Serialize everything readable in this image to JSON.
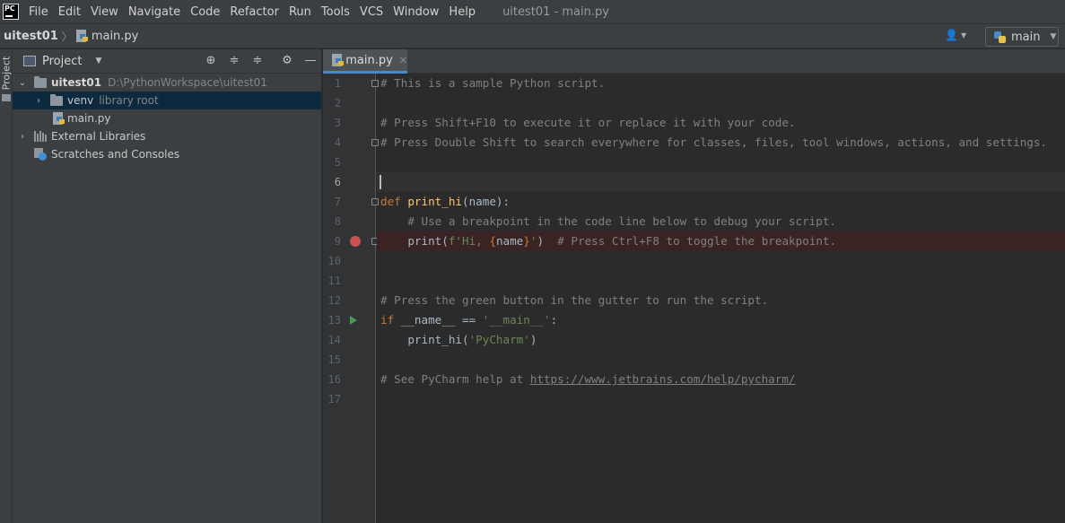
{
  "menubar": {
    "logo_text": "PC",
    "items": [
      "File",
      "Edit",
      "View",
      "Navigate",
      "Code",
      "Refactor",
      "Run",
      "Tools",
      "VCS",
      "Window",
      "Help"
    ],
    "window_title": "uitest01 - main.py"
  },
  "navbar": {
    "project": "uitest01",
    "file": "main.py",
    "run_config": "main"
  },
  "tool_strip": {
    "project_label": "Project"
  },
  "project_panel": {
    "title": "Project",
    "tree": {
      "root_name": "uitest01",
      "root_path": "D:\\PythonWorkspace\\uitest01",
      "venv_name": "venv",
      "venv_note": "library root",
      "file_name": "main.py",
      "ext_libs": "External Libraries",
      "scratches": "Scratches and Consoles"
    }
  },
  "editor": {
    "tab_label": "main.py",
    "line_numbers": [
      "1",
      "2",
      "3",
      "4",
      "5",
      "6",
      "7",
      "8",
      "9",
      "10",
      "11",
      "12",
      "13",
      "14",
      "15",
      "16",
      "17"
    ],
    "code": {
      "l1": "# This is a sample Python script.",
      "l3": "# Press Shift+F10 to execute it or replace it with your code.",
      "l4": "# Press Double Shift to search everywhere for classes, files, tool windows, actions, and settings.",
      "l7_kw": "def",
      "l7_fn": "print_hi",
      "l7_rest": "(name):",
      "l8": "# Use a breakpoint in the code line below to debug your script.",
      "l9_a": "print(",
      "l9_str1": "f'Hi, ",
      "l9_f1": "{",
      "l9_var": "name",
      "l9_f2": "}",
      "l9_str2": "'",
      "l9_b": ")",
      "l9_cmt": "# Press Ctrl+F8 to toggle the breakpoint.",
      "l12": "# Press the green button in the gutter to run the script.",
      "l13_kw": "if",
      "l13_mid": " __name__ == ",
      "l13_str": "'__main__'",
      "l13_end": ":",
      "l14_a": "print_hi(",
      "l14_str": "'PyCharm'",
      "l14_b": ")",
      "l16_pre": "# See PyCharm help at ",
      "l16_url": "https://www.jetbrains.com/help/pycharm/"
    }
  },
  "colors": {
    "keyword": "#cc7832",
    "function": "#ffc66d",
    "string": "#6a8759",
    "comment": "#808080",
    "breakpoint": "#c75450",
    "run": "#499c54",
    "selection": "#0d293e"
  }
}
